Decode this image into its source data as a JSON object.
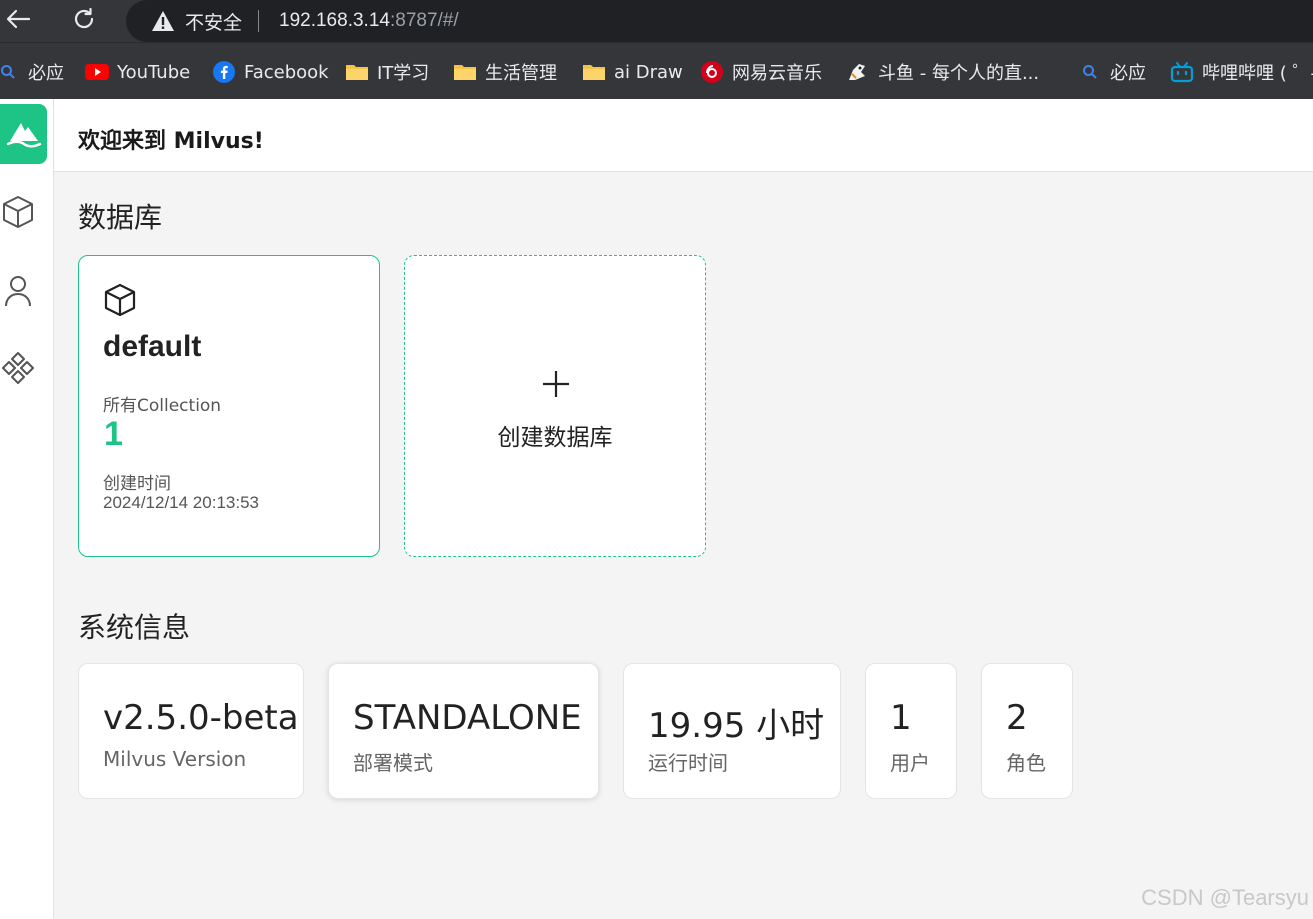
{
  "browser": {
    "insecure_label": "不安全",
    "url_host": "192.168.3.14",
    "url_rest": ":8787/#/"
  },
  "bookmarks": [
    {
      "label": "必应",
      "icon": "search-icon"
    },
    {
      "label": "YouTube",
      "icon": "youtube-icon"
    },
    {
      "label": "Facebook",
      "icon": "facebook-icon"
    },
    {
      "label": "IT学习",
      "icon": "folder-icon"
    },
    {
      "label": "生活管理",
      "icon": "folder-icon"
    },
    {
      "label": "ai Draw",
      "icon": "folder-icon"
    },
    {
      "label": "网易云音乐",
      "icon": "netease-music-icon"
    },
    {
      "label": "斗鱼 - 每个人的直...",
      "icon": "douyu-icon"
    },
    {
      "label": "必应",
      "icon": "search-icon"
    },
    {
      "label": "哔哩哔哩 ( ゜-",
      "icon": "bilibili-icon"
    }
  ],
  "header": {
    "welcome": "欢迎来到 Milvus!"
  },
  "databases": {
    "title": "数据库",
    "cards": [
      {
        "name": "default",
        "collections_label": "所有Collection",
        "collections_count": "1",
        "created_label": "创建时间",
        "created_at": "2024/12/14 20:13:53"
      }
    ],
    "create_label": "创建数据库"
  },
  "system": {
    "title": "系统信息",
    "cards": [
      {
        "value": "v2.5.0-beta",
        "label": "Milvus Version"
      },
      {
        "value": "STANDALONE",
        "label": "部署模式"
      },
      {
        "value": "19.95 小时",
        "label": "运行时间"
      },
      {
        "value": "1",
        "label": "用户"
      },
      {
        "value": "2",
        "label": "角色"
      }
    ]
  },
  "watermark": "CSDN @Tearsyu",
  "colors": {
    "accent": "#1ec386",
    "browser_bg": "#35363a"
  }
}
